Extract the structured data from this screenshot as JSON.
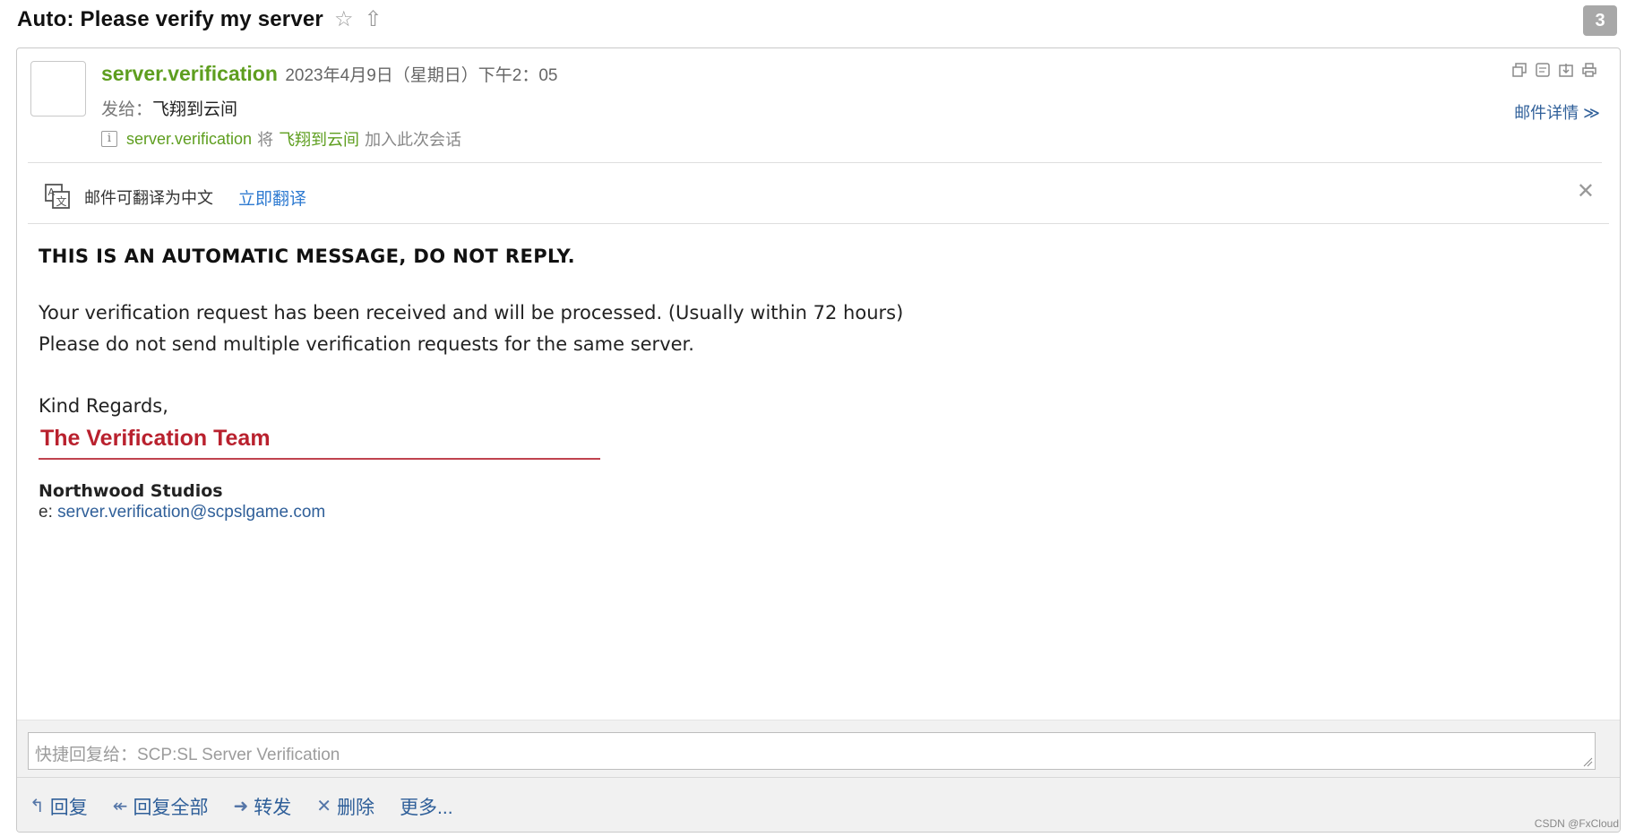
{
  "mail": {
    "title": "Auto: Please verify my server",
    "counter": "3"
  },
  "header": {
    "sender": "server.verification",
    "date": "2023年4月9日（星期日）下午2：05",
    "to_label": "发给：",
    "to_value": "飞翔到云间",
    "info_sender": "server.verification",
    "info_join": "将",
    "info_user": "飞翔到云间",
    "info_action": "加入此次会话",
    "details": "邮件详情 ≫"
  },
  "translate": {
    "text": "邮件可翻译为中文",
    "link": "立即翻译"
  },
  "body": {
    "notice": "THIS IS AN AUTOMATIC MESSAGE, DO NOT REPLY.",
    "line1": "Your verification request has been received and will be processed. (Usually within 72 hours)",
    "line2": "Please do not send multiple verification requests for the same server.",
    "regards": "Kind Regards,",
    "team": "The Verification Team",
    "company": "Northwood Studios",
    "email_prefix": "e: ",
    "email": "server.verification@scpslgame.com"
  },
  "quick_reply": {
    "placeholder": "快捷回复给：SCP:SL Server Verification"
  },
  "actions": {
    "reply": "回复",
    "reply_all": "回复全部",
    "forward": "转发",
    "delete": "删除",
    "more": "更多..."
  },
  "watermark": "CSDN @FxCloud",
  "colors": {
    "sender_green": "#5e9e1f",
    "link_blue": "#2f5f99",
    "team_red": "#b9212e"
  }
}
